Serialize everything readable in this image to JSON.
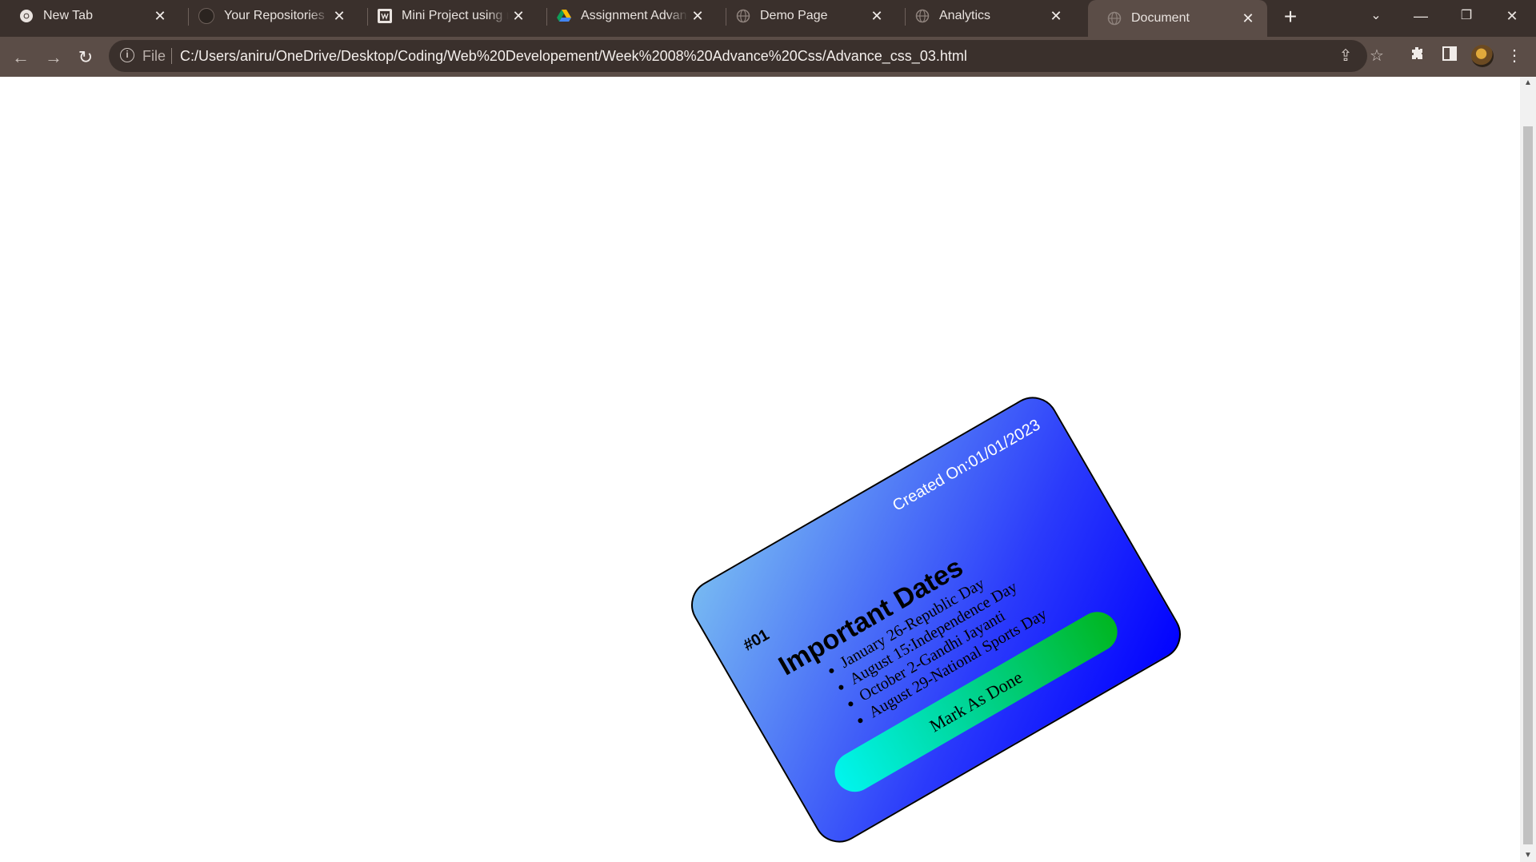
{
  "browser": {
    "tabs": [
      {
        "title": "New Tab",
        "favicon": "chrome-icon",
        "active": false
      },
      {
        "title": "Your Repositories",
        "favicon": "github-icon",
        "active": false
      },
      {
        "title": "Mini Project using m",
        "favicon": "project-icon",
        "active": false
      },
      {
        "title": "Assignment Advance",
        "favicon": "google-drive-icon",
        "active": false
      },
      {
        "title": "Demo Page",
        "favicon": "globe-icon",
        "active": false
      },
      {
        "title": "Analytics",
        "favicon": "globe-icon",
        "active": false
      },
      {
        "title": "Document",
        "favicon": "globe-icon",
        "active": true
      }
    ],
    "address_bar": {
      "scheme_label": "File",
      "url": "C:/Users/aniru/OneDrive/Desktop/Coding/Web%20Developement/Week%2008%20Advance%20Css/Advance_css_03.html"
    }
  },
  "card": {
    "number": "#01",
    "created": "Created On:01/01/2023",
    "title": "Important Dates",
    "items": [
      "January 26-Republic Day",
      "August 15:Independence Day",
      "October 2-Gandhi Jayanti",
      "August 29-National Sports Day"
    ],
    "button_label": "Mark As Done"
  },
  "colors": {
    "card_gradient": [
      "#0000ff",
      "#78bbf2"
    ],
    "button_gradient": [
      "#00f5ee",
      "#00b620"
    ],
    "tabbar_bg": "#3a302c",
    "toolbar_bg": "#5b4d47"
  }
}
